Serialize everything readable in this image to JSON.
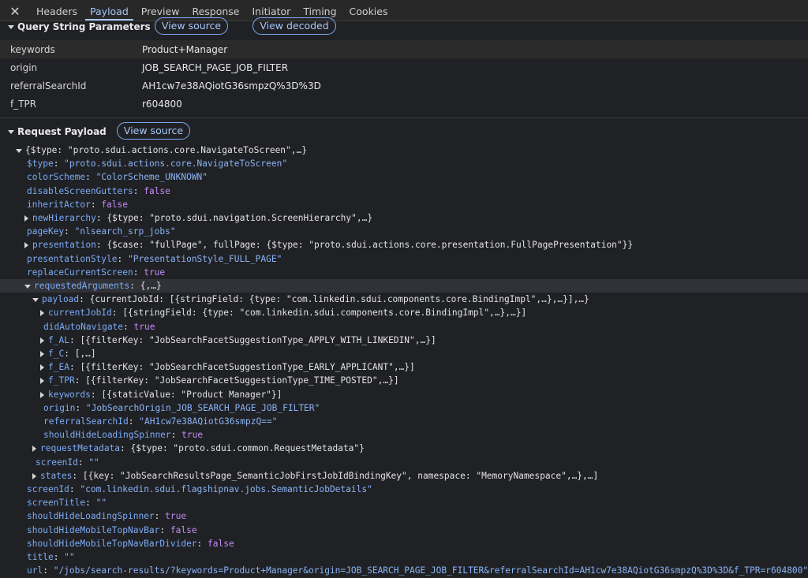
{
  "tabs": [
    "Headers",
    "Payload",
    "Preview",
    "Response",
    "Initiator",
    "Timing",
    "Cookies"
  ],
  "active_tab": "Payload",
  "query_section": {
    "title": "Query String Parameters",
    "view_source": "View source",
    "view_decoded": "View decoded",
    "params": [
      {
        "key": "keywords",
        "value": "Product+Manager"
      },
      {
        "key": "origin",
        "value": "JOB_SEARCH_PAGE_JOB_FILTER"
      },
      {
        "key": "referralSearchId",
        "value": "AH1cw7e38AQiotG36smpzQ%3D%3D"
      },
      {
        "key": "f_TPR",
        "value": "r604800"
      }
    ]
  },
  "payload_section": {
    "title": "Request Payload",
    "view_source": "View source"
  },
  "tree": {
    "root": "{$type: \"proto.sdui.actions.core.NavigateToScreen\",…}",
    "lines": [
      {
        "key": "$type",
        "value": "\"proto.sdui.actions.core.NavigateToScreen\""
      },
      {
        "key": "colorScheme",
        "value": "\"ColorScheme_UNKNOWN\""
      },
      {
        "key": "disableScreenGutters",
        "value": "false"
      },
      {
        "key": "inheritActor",
        "value": "false"
      },
      {
        "key": "newHierarchy",
        "value": "{$type: \"proto.sdui.navigation.ScreenHierarchy\",…}"
      },
      {
        "key": "pageKey",
        "value": "\"nlsearch_srp_jobs\""
      },
      {
        "key": "presentation",
        "value": "{$case: \"fullPage\", fullPage: {$type: \"proto.sdui.actions.core.presentation.FullPagePresentation\"}}"
      },
      {
        "key": "presentationStyle",
        "value": "\"PresentationStyle_FULL_PAGE\""
      },
      {
        "key": "replaceCurrentScreen",
        "value": "true"
      },
      {
        "key": "requestedArguments",
        "value": "{,…}"
      },
      {
        "key": "payload",
        "value": "{currentJobId: [{stringField: {type: \"com.linkedin.sdui.components.core.BindingImpl\",…},…}],…}"
      },
      {
        "key": "currentJobId",
        "value": "[{stringField: {type: \"com.linkedin.sdui.components.core.BindingImpl\",…},…}]"
      },
      {
        "key": "didAutoNavigate",
        "value": "true"
      },
      {
        "key": "f_AL",
        "value": "[{filterKey: \"JobSearchFacetSuggestionType_APPLY_WITH_LINKEDIN\",…}]"
      },
      {
        "key": "f_C",
        "value": "[,…]"
      },
      {
        "key": "f_EA",
        "value": "[{filterKey: \"JobSearchFacetSuggestionType_EARLY_APPLICANT\",…}]"
      },
      {
        "key": "f_TPR",
        "value": "[{filterKey: \"JobSearchFacetSuggestionType_TIME_POSTED\",…}]"
      },
      {
        "key": "keywords",
        "value": "[{staticValue: \"Product Manager\"}]"
      },
      {
        "key": "origin",
        "value": "\"JobSearchOrigin_JOB_SEARCH_PAGE_JOB_FILTER\""
      },
      {
        "key": "referralSearchId",
        "value": "\"AH1cw7e38AQiotG36smpzQ==\""
      },
      {
        "key": "shouldHideLoadingSpinner",
        "value": "true"
      },
      {
        "key": "requestMetadata",
        "value": "{$type: \"proto.sdui.common.RequestMetadata\"}"
      },
      {
        "key": "screenId",
        "value": "\"\""
      },
      {
        "key": "states",
        "value": "[{key: \"JobSearchResultsPage_SemanticJobFirstJobIdBindingKey\", namespace: \"MemoryNamespace\",…},…]"
      },
      {
        "key": "screenId",
        "value": "\"com.linkedin.sdui.flagshipnav.jobs.SemanticJobDetails\""
      },
      {
        "key": "screenTitle",
        "value": "\"\""
      },
      {
        "key": "shouldHideLoadingSpinner",
        "value": "true"
      },
      {
        "key": "shouldHideMobileTopNavBar",
        "value": "false"
      },
      {
        "key": "shouldHideMobileTopNavBarDivider",
        "value": "false"
      },
      {
        "key": "title",
        "value": "\"\""
      },
      {
        "key": "url",
        "value": "\"/jobs/search-results/?keywords=Product+Manager&origin=JOB_SEARCH_PAGE_JOB_FILTER&referralSearchId=AH1cw7e38AQiotG36smpzQ%3D%3D&f_TPR=r604800\""
      }
    ]
  }
}
